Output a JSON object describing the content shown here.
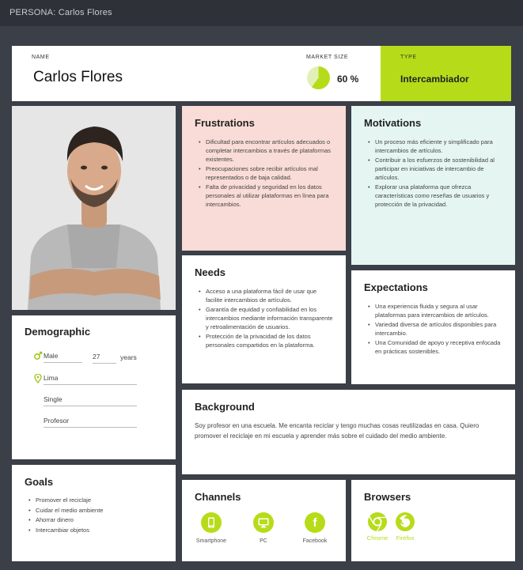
{
  "topbar": {
    "prefix": "PERSONA:",
    "name": "Carlos Flores"
  },
  "header": {
    "name_label": "NAME",
    "name": "Carlos Flores",
    "market_label": "MARKET SIZE",
    "market_value": "60 %",
    "market_fraction": 0.6,
    "type_label": "TYPE",
    "type_value": "Intercambiador"
  },
  "colors": {
    "accent": "#b6dc19",
    "frustrations_bg": "#f9dcd7",
    "motivations_bg": "#e5f6f2",
    "background": "#3b3f47"
  },
  "frustrations": {
    "title": "Frustrations",
    "items": [
      "Dificultad para encontrar artículos adecuados o completar intercambios a través de plataformas existentes.",
      "Preocupaciones sobre recibir artículos mal representados o de baja calidad.",
      "Falta de privacidad y seguridad en los datos personales al utilizar plataformas en línea para intercambios."
    ]
  },
  "motivations": {
    "title": "Motivations",
    "items": [
      "Un proceso más eficiente y simplificado para intercambios de artículos.",
      "Contribuir a los esfuerzos de sostenibilidad al participar en iniciativas de intercambio de artículos.",
      "Explorar una plataforma que ofrezca características como reseñas de usuarios y protección de la privacidad."
    ]
  },
  "needs": {
    "title": "Needs",
    "items": [
      "Acceso a una plataforma fácil de usar que facilite intercambios de artículos.",
      "Garantía de equidad y confiabilidad en los intercambios mediante información transparente y retroalimentación de usuarios.",
      "Protección de la privacidad de los datos personales compartidos en la plataforma."
    ]
  },
  "expectations": {
    "title": "Expectations",
    "items": [
      "Una experiencia fluida y segura al usar plataformas para intercambios de artículos.",
      "Variedad diversa de artículos disponibles para intercambio.",
      "Una Comunidad de apoyo y receptiva enfocada en prácticas sostenibles."
    ]
  },
  "demographic": {
    "title": "Demographic",
    "gender": "Male",
    "age": "27",
    "age_unit": "years",
    "location": "Lima",
    "status": "Single",
    "occupation": "Profesor",
    "gender_icon": "male-icon",
    "location_icon": "location-pin-icon"
  },
  "goals": {
    "title": "Goals",
    "items": [
      "Promover el reciclaje",
      "Cuidar el medio ambiente",
      "Ahorrar dinero",
      "Intercambiar objetos"
    ]
  },
  "background": {
    "title": "Background",
    "text": "Soy profesor en una escuela. Me encanta reciclar y tengo muchas cosas reutilizadas en casa. Quiero promover el reciclaje en mi escuela y aprender más sobre el cuidado del medio ambiente."
  },
  "channels": {
    "title": "Channels",
    "items": [
      {
        "label": "Smartphone",
        "icon": "smartphone-icon"
      },
      {
        "label": "PC",
        "icon": "monitor-icon"
      },
      {
        "label": "Facebook",
        "icon": "facebook-icon"
      }
    ]
  },
  "browsers": {
    "title": "Browsers",
    "items": [
      {
        "label": "Chrome",
        "icon": "chrome-icon"
      },
      {
        "label": "Firefox",
        "icon": "firefox-icon"
      }
    ]
  }
}
